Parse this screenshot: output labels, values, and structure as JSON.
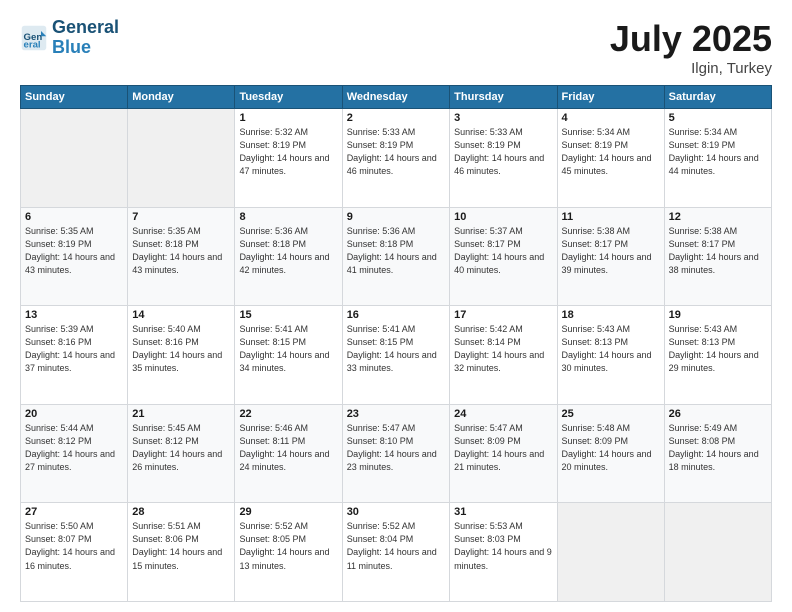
{
  "header": {
    "logo_line1": "General",
    "logo_line2": "Blue",
    "title": "July 2025",
    "subtitle": "Ilgin, Turkey"
  },
  "weekdays": [
    "Sunday",
    "Monday",
    "Tuesday",
    "Wednesday",
    "Thursday",
    "Friday",
    "Saturday"
  ],
  "weeks": [
    [
      {
        "day": "",
        "info": ""
      },
      {
        "day": "",
        "info": ""
      },
      {
        "day": "1",
        "info": "Sunrise: 5:32 AM\nSunset: 8:19 PM\nDaylight: 14 hours and 47 minutes."
      },
      {
        "day": "2",
        "info": "Sunrise: 5:33 AM\nSunset: 8:19 PM\nDaylight: 14 hours and 46 minutes."
      },
      {
        "day": "3",
        "info": "Sunrise: 5:33 AM\nSunset: 8:19 PM\nDaylight: 14 hours and 46 minutes."
      },
      {
        "day": "4",
        "info": "Sunrise: 5:34 AM\nSunset: 8:19 PM\nDaylight: 14 hours and 45 minutes."
      },
      {
        "day": "5",
        "info": "Sunrise: 5:34 AM\nSunset: 8:19 PM\nDaylight: 14 hours and 44 minutes."
      }
    ],
    [
      {
        "day": "6",
        "info": "Sunrise: 5:35 AM\nSunset: 8:19 PM\nDaylight: 14 hours and 43 minutes."
      },
      {
        "day": "7",
        "info": "Sunrise: 5:35 AM\nSunset: 8:18 PM\nDaylight: 14 hours and 43 minutes."
      },
      {
        "day": "8",
        "info": "Sunrise: 5:36 AM\nSunset: 8:18 PM\nDaylight: 14 hours and 42 minutes."
      },
      {
        "day": "9",
        "info": "Sunrise: 5:36 AM\nSunset: 8:18 PM\nDaylight: 14 hours and 41 minutes."
      },
      {
        "day": "10",
        "info": "Sunrise: 5:37 AM\nSunset: 8:17 PM\nDaylight: 14 hours and 40 minutes."
      },
      {
        "day": "11",
        "info": "Sunrise: 5:38 AM\nSunset: 8:17 PM\nDaylight: 14 hours and 39 minutes."
      },
      {
        "day": "12",
        "info": "Sunrise: 5:38 AM\nSunset: 8:17 PM\nDaylight: 14 hours and 38 minutes."
      }
    ],
    [
      {
        "day": "13",
        "info": "Sunrise: 5:39 AM\nSunset: 8:16 PM\nDaylight: 14 hours and 37 minutes."
      },
      {
        "day": "14",
        "info": "Sunrise: 5:40 AM\nSunset: 8:16 PM\nDaylight: 14 hours and 35 minutes."
      },
      {
        "day": "15",
        "info": "Sunrise: 5:41 AM\nSunset: 8:15 PM\nDaylight: 14 hours and 34 minutes."
      },
      {
        "day": "16",
        "info": "Sunrise: 5:41 AM\nSunset: 8:15 PM\nDaylight: 14 hours and 33 minutes."
      },
      {
        "day": "17",
        "info": "Sunrise: 5:42 AM\nSunset: 8:14 PM\nDaylight: 14 hours and 32 minutes."
      },
      {
        "day": "18",
        "info": "Sunrise: 5:43 AM\nSunset: 8:13 PM\nDaylight: 14 hours and 30 minutes."
      },
      {
        "day": "19",
        "info": "Sunrise: 5:43 AM\nSunset: 8:13 PM\nDaylight: 14 hours and 29 minutes."
      }
    ],
    [
      {
        "day": "20",
        "info": "Sunrise: 5:44 AM\nSunset: 8:12 PM\nDaylight: 14 hours and 27 minutes."
      },
      {
        "day": "21",
        "info": "Sunrise: 5:45 AM\nSunset: 8:12 PM\nDaylight: 14 hours and 26 minutes."
      },
      {
        "day": "22",
        "info": "Sunrise: 5:46 AM\nSunset: 8:11 PM\nDaylight: 14 hours and 24 minutes."
      },
      {
        "day": "23",
        "info": "Sunrise: 5:47 AM\nSunset: 8:10 PM\nDaylight: 14 hours and 23 minutes."
      },
      {
        "day": "24",
        "info": "Sunrise: 5:47 AM\nSunset: 8:09 PM\nDaylight: 14 hours and 21 minutes."
      },
      {
        "day": "25",
        "info": "Sunrise: 5:48 AM\nSunset: 8:09 PM\nDaylight: 14 hours and 20 minutes."
      },
      {
        "day": "26",
        "info": "Sunrise: 5:49 AM\nSunset: 8:08 PM\nDaylight: 14 hours and 18 minutes."
      }
    ],
    [
      {
        "day": "27",
        "info": "Sunrise: 5:50 AM\nSunset: 8:07 PM\nDaylight: 14 hours and 16 minutes."
      },
      {
        "day": "28",
        "info": "Sunrise: 5:51 AM\nSunset: 8:06 PM\nDaylight: 14 hours and 15 minutes."
      },
      {
        "day": "29",
        "info": "Sunrise: 5:52 AM\nSunset: 8:05 PM\nDaylight: 14 hours and 13 minutes."
      },
      {
        "day": "30",
        "info": "Sunrise: 5:52 AM\nSunset: 8:04 PM\nDaylight: 14 hours and 11 minutes."
      },
      {
        "day": "31",
        "info": "Sunrise: 5:53 AM\nSunset: 8:03 PM\nDaylight: 14 hours and 9 minutes."
      },
      {
        "day": "",
        "info": ""
      },
      {
        "day": "",
        "info": ""
      }
    ]
  ]
}
